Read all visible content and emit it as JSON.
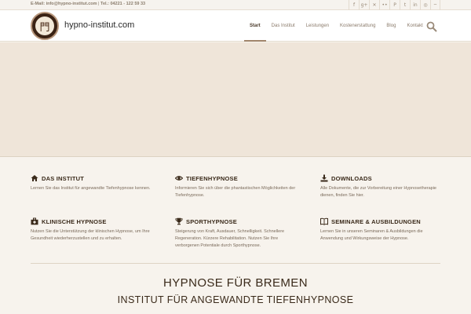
{
  "topbar": {
    "email_label": "E-Mail:",
    "email": "info@hypno-institut.com",
    "separator": " | ",
    "phone_label": "Tel.:",
    "phone": "04221 - 122 59 33",
    "social_icons": [
      "facebook-icon",
      "googleplus-icon",
      "xing-icon",
      "flickr-icon",
      "pinterest-icon",
      "twitter-icon",
      "linkedin-icon",
      "instagram-icon",
      "rss-icon"
    ]
  },
  "header": {
    "logo_glyph": "門",
    "site_name": "hypno-institut.com",
    "nav": [
      "Start",
      "Das Institut",
      "Leistungen",
      "Kostenerstattung",
      "Blog",
      "Kontakt"
    ],
    "active_nav": "Start"
  },
  "features": [
    {
      "icon": "home-icon",
      "title": "DAS INSTITUT",
      "text": "Lernen Sie das Institut für angewandte Tiefenhypnose kennen."
    },
    {
      "icon": "eye-icon",
      "title": "TIEFENHYPNOSE",
      "text": "Informieren Sie sich über die phantastischen Möglichkeiten der Tiefenhypnose."
    },
    {
      "icon": "download-icon",
      "title": "DOWNLOADS",
      "text": "Alle Dokumente, die zur Vorbereitung einer Hypnosetherapie dienen, finden Sie hier."
    },
    {
      "icon": "medical-kit-icon",
      "title": "KLINISCHE HYPNOSE",
      "text": "Nutzen Sie die Unterstützung der klinischen Hypnose, um Ihre Gesundheit wiederherzustellen und zu erhalten."
    },
    {
      "icon": "trophy-icon",
      "title": "SPORTHYPNOSE",
      "text": "Steigerung von Kraft, Ausdauer, Schnelligkeit. Schnellere Regeneration. Kürzere Rehabilitation. Nutzen Sie Ihre verborgenen Potentiale durch Sporthypnose."
    },
    {
      "icon": "book-icon",
      "title": "SEMINARE & AUSBILDUNGEN",
      "text": "Lernen Sie in unseren Seminaren & Ausbildungen die Anwendung und Wirkungsweise der Hypnose."
    }
  ],
  "headline": "HYPNOSE FÜR BREMEN",
  "subheadline": "INSTITUT FÜR ANGEWANDTE TIEFENHYPNOSE",
  "colors": {
    "accent": "#a0846a",
    "hero_bg": "#efe5d9",
    "text_dark": "#3a2a1a"
  }
}
